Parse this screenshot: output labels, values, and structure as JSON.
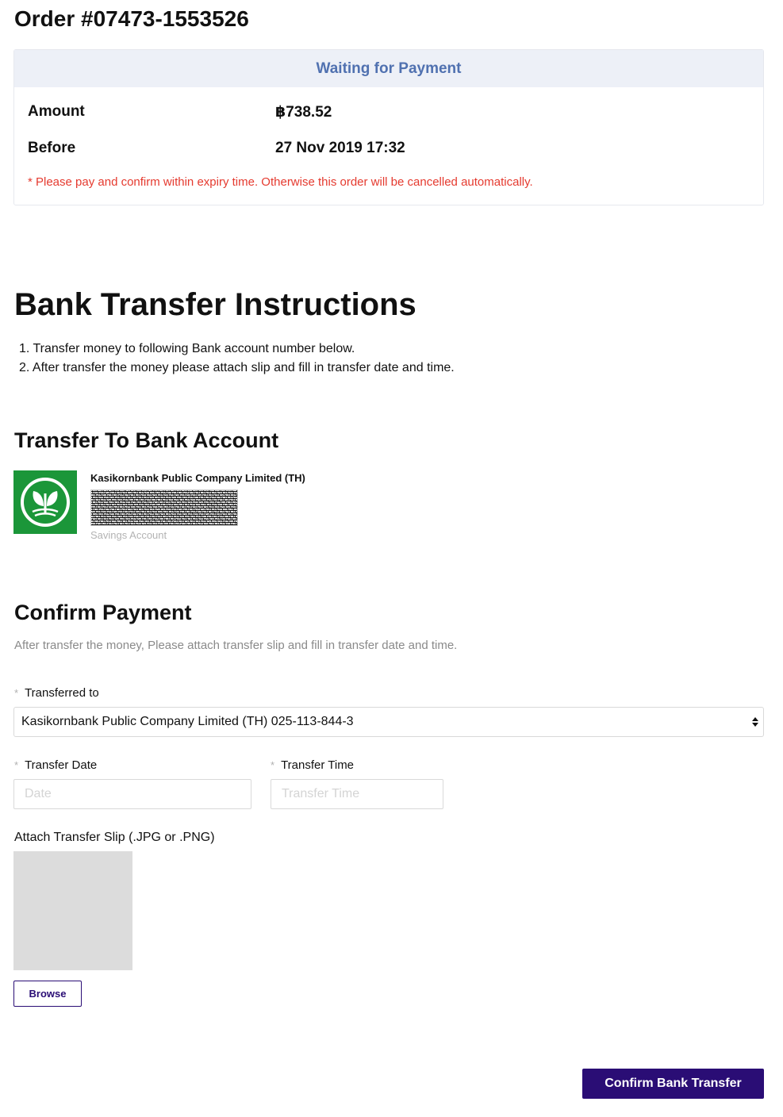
{
  "order": {
    "title": "Order #07473-1553526"
  },
  "status": {
    "header": "Waiting for Payment",
    "amount_label": "Amount",
    "amount_value": "฿738.52",
    "before_label": "Before",
    "before_value": "27 Nov 2019 17:32",
    "warning": "* Please pay and confirm within expiry time. Otherwise this order will be cancelled automatically.",
    "warning_color": "#e53a2f",
    "header_color": "#5071b0"
  },
  "instructions": {
    "heading": "Bank Transfer Instructions",
    "steps": [
      "1. Transfer money to following Bank account number below.",
      "2. After transfer the money please attach slip and fill in transfer date and time."
    ]
  },
  "transfer_to": {
    "heading": "Transfer To Bank Account",
    "bank_name": "Kasikornbank Public Company Limited (TH)",
    "account_type": "Savings Account",
    "logo_icon": "kasikorn-leaf-icon",
    "logo_color": "#1b9639"
  },
  "confirm": {
    "heading": "Confirm Payment",
    "description": "After transfer the money, Please attach transfer slip and fill in transfer date and time.",
    "transferred_to_label": "Transferred to",
    "transferred_to_value": "Kasikornbank Public Company Limited (TH) 025-113-844-3",
    "date_label": "Transfer Date",
    "date_placeholder": "Date",
    "time_label": "Transfer Time",
    "time_placeholder": "Transfer Time",
    "required_mark": "*",
    "attach_label": "Attach Transfer Slip (.JPG or .PNG)",
    "browse_label": "Browse",
    "submit_label": "Confirm Bank Transfer",
    "primary_color": "#2a0d75"
  }
}
